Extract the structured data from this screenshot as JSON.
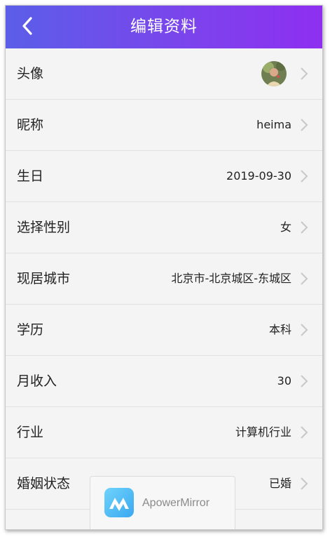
{
  "header": {
    "title": "编辑资料",
    "back_icon": "chevron-left-icon",
    "gradient_colors": [
      "#5b5ee8",
      "#8e2ff0"
    ]
  },
  "rows": [
    {
      "label": "头像",
      "value": "",
      "type": "avatar"
    },
    {
      "label": "昵称",
      "value": "heima"
    },
    {
      "label": "生日",
      "value": "2019-09-30"
    },
    {
      "label": "选择性别",
      "value": "女"
    },
    {
      "label": "现居城市",
      "value": "北京市-北京城区-东城区"
    },
    {
      "label": "学历",
      "value": "本科"
    },
    {
      "label": "月收入",
      "value": "30"
    },
    {
      "label": "行业",
      "value": "计算机行业"
    },
    {
      "label": "婚姻状态",
      "value": "已婚"
    }
  ],
  "watermark": {
    "text": "ApowerMirror",
    "logo_color": "#4fc3f7"
  }
}
